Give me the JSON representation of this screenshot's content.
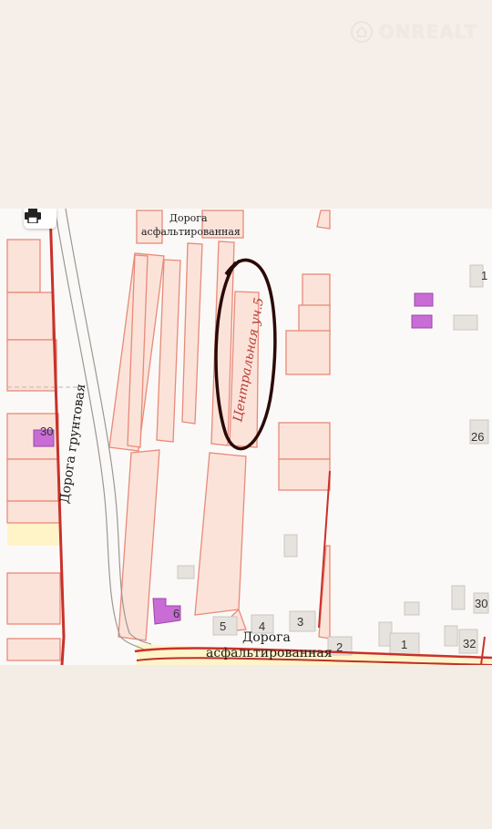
{
  "watermark": "ONREALT",
  "map": {
    "print_icon": "printer-icon",
    "labels": {
      "road_top_1": "Дорога",
      "road_top_2": "асфальтированная",
      "road_bottom_1": "Дорога",
      "road_bottom_2": "асфальтированная",
      "road_dirt": "Дорога грунтовая",
      "central_plot": "Центральная уч.5"
    },
    "house_numbers": [
      "30",
      "26",
      "6",
      "5",
      "4",
      "3",
      "2",
      "1",
      "30",
      "32",
      "1"
    ],
    "colors": {
      "parcel_fill": "#fbe3da",
      "parcel_stroke": "#e88a78",
      "building_fill": "#c96cd6",
      "road_fill": "#fff3c8",
      "red_line": "#c8312b",
      "marker": "#2a0a08"
    }
  }
}
